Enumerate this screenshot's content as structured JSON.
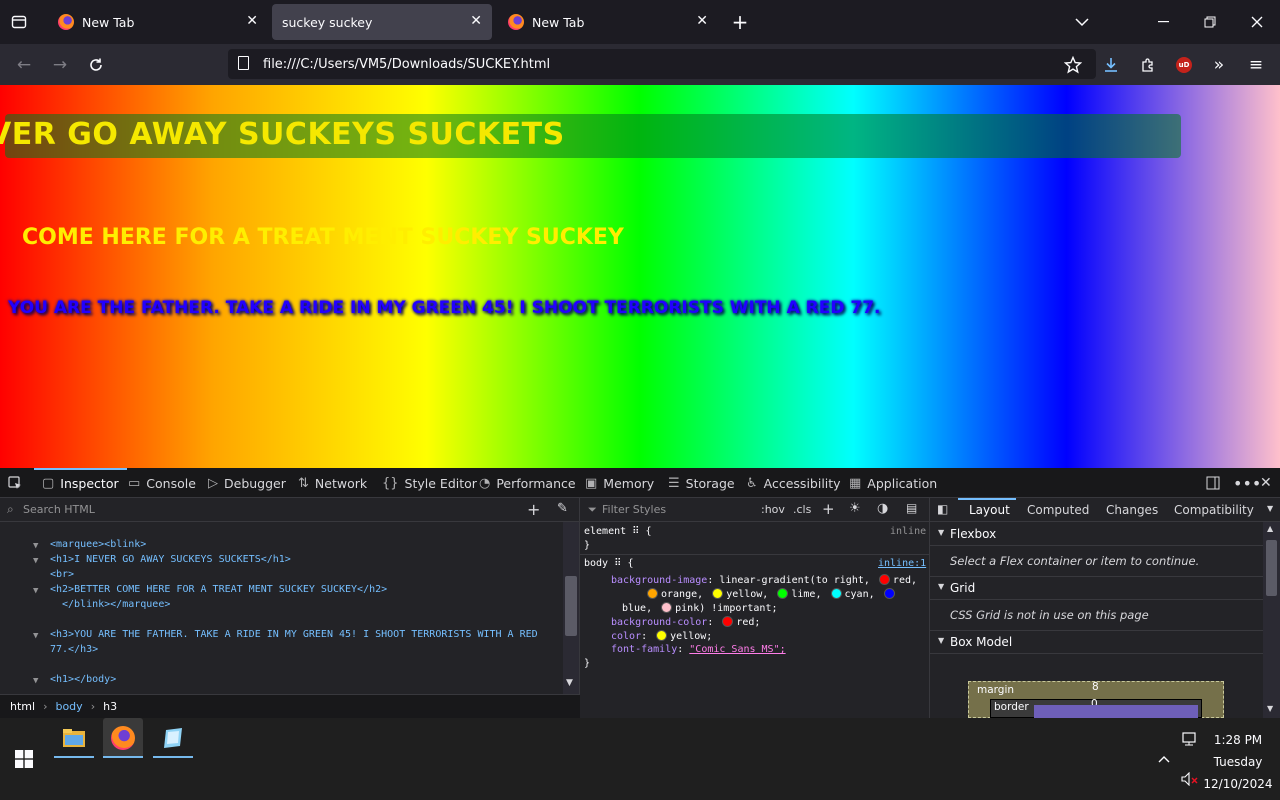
{
  "browser": {
    "tabs": [
      {
        "title": "New Tab",
        "selected": false
      },
      {
        "title": "suckey suckey",
        "selected": true
      },
      {
        "title": "New Tab",
        "selected": false
      }
    ],
    "url": "file:///C:/Users/VM5/Downloads/SUCKEY.html"
  },
  "page": {
    "h1": "VER GO AWAY SUCKEYS SUCKETS",
    "h2": "COME HERE FOR A TREAT MENT SUCKEY SUCKEY",
    "h3": "YOU ARE THE FATHER. TAKE A RIDE IN MY GREEN 45! I SHOOT TERRORISTS WITH A RED 77."
  },
  "devtools": {
    "tabs": [
      "Inspector",
      "Console",
      "Debugger",
      "Network",
      "Style Editor",
      "Performance",
      "Memory",
      "Storage",
      "Accessibility",
      "Application"
    ],
    "search_placeholder": "Search HTML",
    "tree": [
      "<marquee><blink>",
      "<h1>I NEVER GO AWAY SUCKEYS SUCKETS</h1>",
      "<br>",
      "<h2>BETTER COME HERE FOR A TREAT MENT SUCKEY SUCKEY</h2>",
      "</blink></marquee>",
      "<h3>YOU ARE THE FATHER. TAKE A RIDE IN MY GREEN 45! I SHOOT TERRORISTS WITH A RED",
      "77.</h3>",
      "<h1></body>"
    ],
    "breadcrumbs": [
      "html",
      "body",
      "h3"
    ],
    "rules": {
      "filter_placeholder": "Filter Styles",
      "hov": ":hov",
      "cls": ".cls",
      "element_selector": "element",
      "element_source": "inline",
      "body_selector": "body",
      "body_source": "inline:1",
      "bg_image_prop": "background-image",
      "bg_image_val": "linear-gradient(to right,",
      "red": "red,",
      "orange": "orange,",
      "yellow": "yellow,",
      "lime": "lime,",
      "cyan": "cyan,",
      "blue": "blue,",
      "pink": "pink) !important;",
      "bg_color_prop": "background-color",
      "bg_color_val": "red;",
      "color_prop": "color",
      "color_val": "yellow;",
      "font_prop": "font-family",
      "font_val": "\"Comic Sans MS\";"
    },
    "layout": {
      "tabs": [
        "Layout",
        "Computed",
        "Changes",
        "Compatibility"
      ],
      "flexbox_title": "Flexbox",
      "flexbox_msg": "Select a Flex container or item to continue.",
      "grid_title": "Grid",
      "grid_msg": "CSS Grid is not in use on this page",
      "boxmodel_title": "Box Model",
      "margin_label": "margin",
      "margin_value": "8",
      "border_label": "border",
      "border_value": "0"
    }
  },
  "taskbar": {
    "time": "1:28 PM",
    "day": "Tuesday",
    "date": "12/10/2024"
  },
  "colors": {
    "swatch_red": "#ff0000",
    "swatch_orange": "#ffa500",
    "swatch_yellow": "#ffff00",
    "swatch_lime": "#00ff00",
    "swatch_cyan": "#00ffff",
    "swatch_blue": "#0000ff",
    "swatch_pink": "#ffc0cb"
  }
}
